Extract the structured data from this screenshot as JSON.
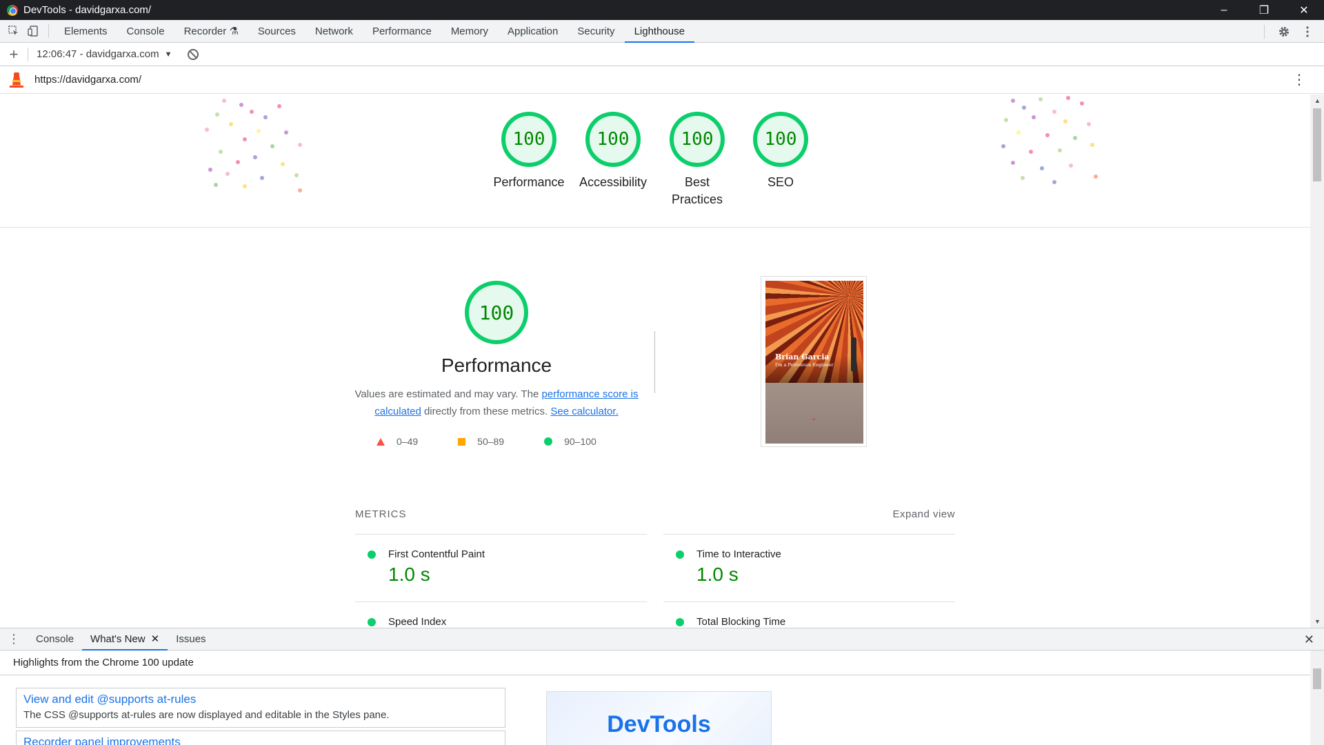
{
  "window": {
    "title": "DevTools - davidgarxa.com/",
    "controls": [
      "–",
      "❐",
      "✕"
    ]
  },
  "tabstrip": {
    "tabs": [
      {
        "label": "Elements"
      },
      {
        "label": "Console"
      },
      {
        "label": "Recorder ⚗"
      },
      {
        "label": "Sources"
      },
      {
        "label": "Network"
      },
      {
        "label": "Performance"
      },
      {
        "label": "Memory"
      },
      {
        "label": "Application"
      },
      {
        "label": "Security"
      },
      {
        "label": "Lighthouse",
        "active": true
      }
    ],
    "icons": [
      "inspect-icon",
      "device-toolbar-icon",
      "settings-icon",
      "more-options-icon"
    ]
  },
  "lh_toolbar": {
    "run_label": "12:06:47 - davidgarxa.com",
    "dropdown": "▼"
  },
  "urlbar": {
    "url": "https://davidgarxa.com/"
  },
  "summary_scores": [
    {
      "score": "100",
      "label": "Performance"
    },
    {
      "score": "100",
      "label": "Accessibility"
    },
    {
      "score": "100",
      "label": "Best Practices"
    },
    {
      "score": "100",
      "label": "SEO"
    }
  ],
  "performance": {
    "score": "100",
    "title": "Performance",
    "desc_pre": "Values are estimated and may vary. The ",
    "desc_link1": "performance score is calculated",
    "desc_mid": " directly from these metrics. ",
    "desc_link2": "See calculator.",
    "legend": [
      {
        "range": "0–49",
        "color": "#ff4e42"
      },
      {
        "range": "50–89",
        "color": "#ffa400"
      },
      {
        "range": "90–100",
        "color": "#0cce6b"
      }
    ],
    "screenshot": {
      "name": "Brian Garcia",
      "subtitle": "I'm a Petroleum Engineer"
    }
  },
  "metrics": {
    "heading": "METRICS",
    "expand_label": "Expand view",
    "items": [
      {
        "label": "First Contentful Paint",
        "value": "1.0 s"
      },
      {
        "label": "Time to Interactive",
        "value": "1.0 s"
      },
      {
        "label": "Speed Index",
        "value": ""
      },
      {
        "label": "Total Blocking Time",
        "value": ""
      }
    ]
  },
  "drawer": {
    "tabs": [
      {
        "label": "Console"
      },
      {
        "label": "What's New",
        "active": true
      },
      {
        "label": "Issues"
      }
    ],
    "header": "Highlights from the Chrome 100 update",
    "cards": [
      {
        "title": "View and edit @supports at-rules",
        "desc": "The CSS @supports at-rules are now displayed and editable in the Styles pane."
      },
      {
        "title": "Recorder panel improvements",
        "desc": ""
      }
    ],
    "promo_text": "DevTools"
  },
  "colors": {
    "pass": "#0cce6b",
    "pass_text": "#008800",
    "accent": "#1a73e8",
    "fail": "#ff4e42",
    "average": "#ffa400"
  }
}
